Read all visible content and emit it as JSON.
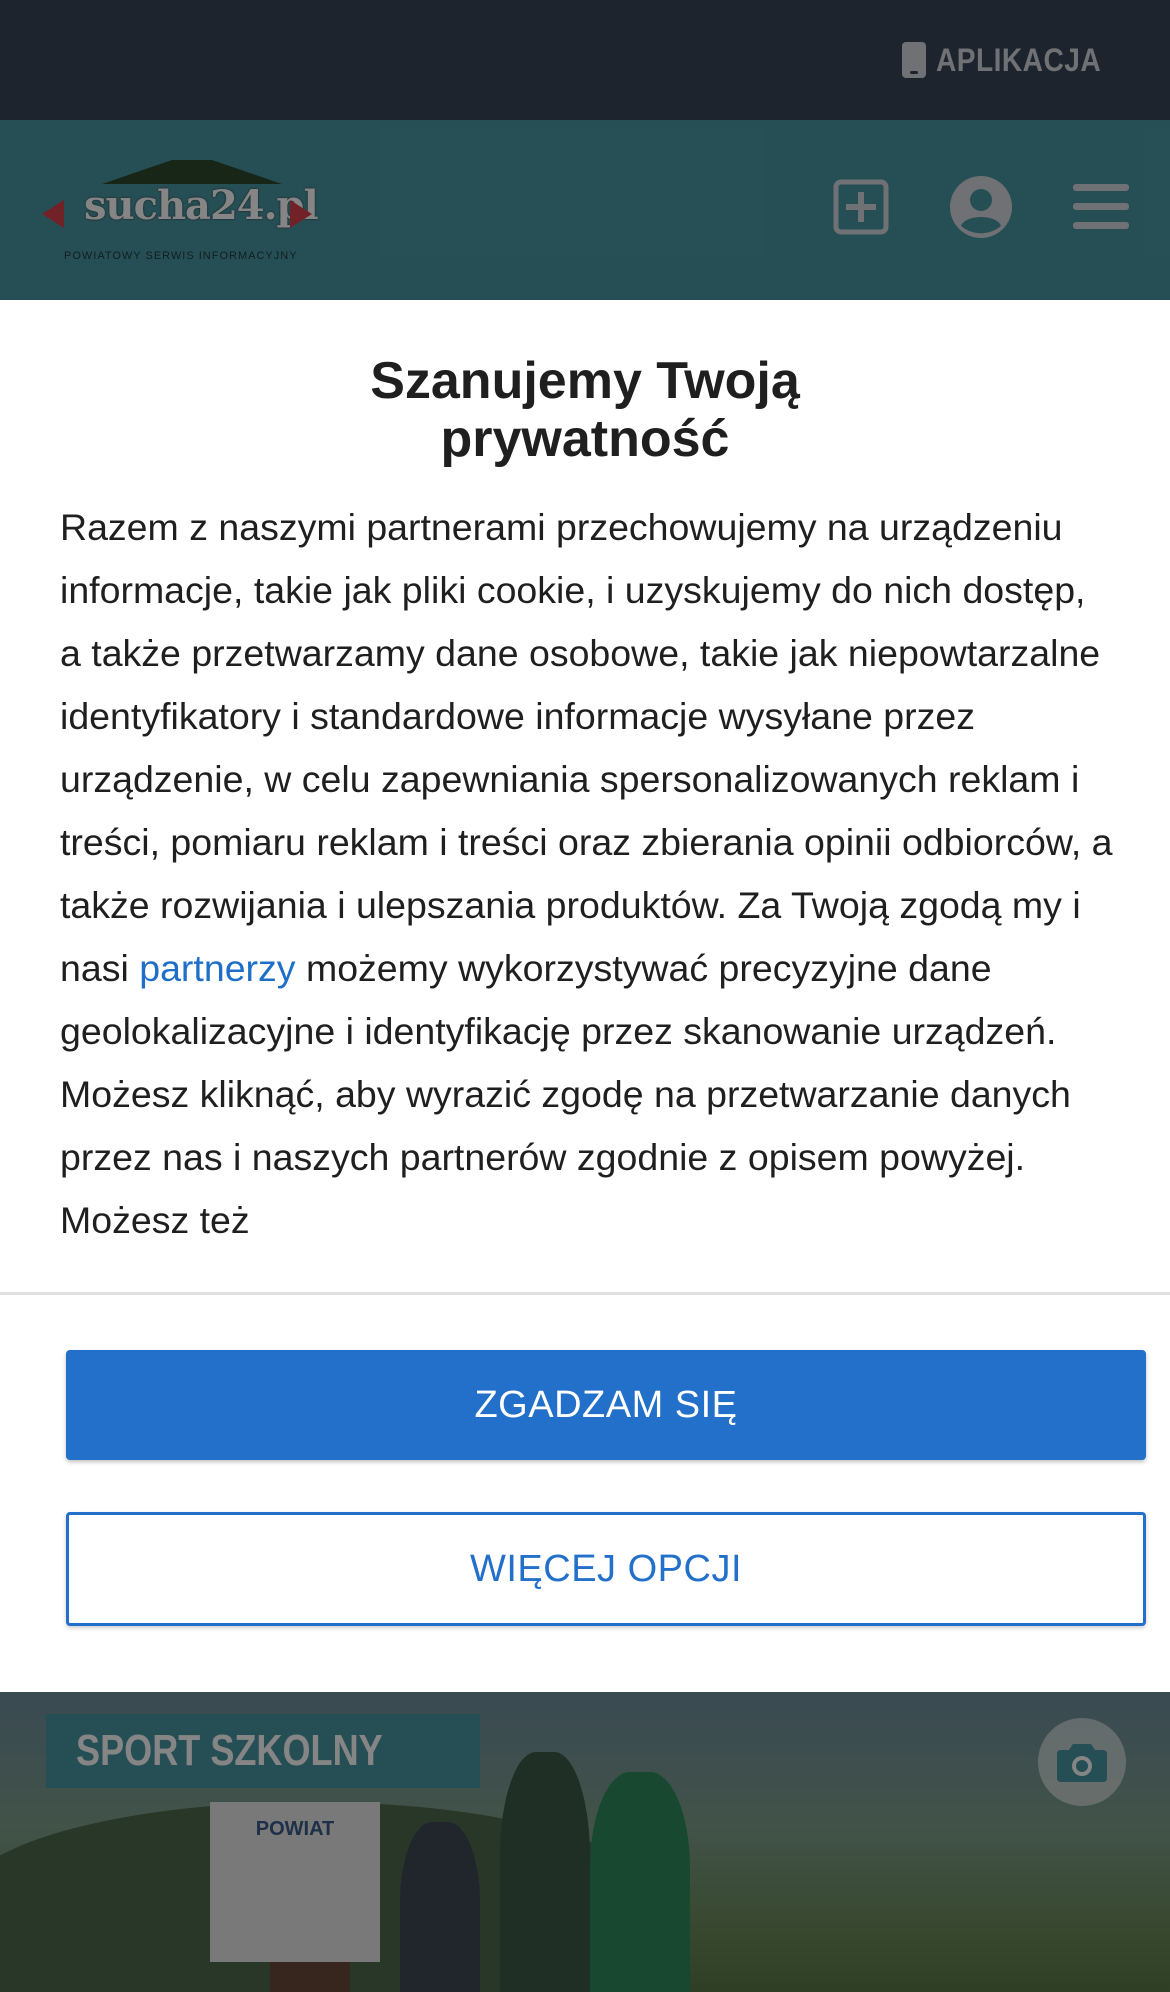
{
  "topbar": {
    "app_label": "APLIKACJA"
  },
  "site": {
    "logo_text": "sucha24.pl",
    "logo_subtitle": "POWIATOWY SERWIS INFORMACYJNY"
  },
  "consent": {
    "title_line1": "Szanujemy Twoją",
    "title_line2": "prywatność",
    "body_part1": "Razem z naszymi partnerami przechowujemy na urządzeniu informacje, takie jak pliki cookie, i uzyskujemy do nich dostęp, a także przetwarzamy dane osobowe, takie jak niepowtarzalne identyfikatory i standardowe informacje wysyłane przez urządzenie, w celu zapewniania spersonalizowanych reklam i treści, pomiaru reklam i treści oraz zbierania opinii odbiorców, a także rozwijania i ulepszania produktów. Za Twoją zgodą my i nasi ",
    "body_link": "partnerzy",
    "body_part2": " możemy wykorzystywać precyzyjne dane geolokalizacyjne i identyfikację przez skanowanie urządzeń. Możesz kliknąć, aby wyrazić zgodę na przetwarzanie danych przez nas i naszych partnerów zgodnie z opisem powyżej. Możesz też",
    "agree_label": "ZGADZAM SIĘ",
    "more_label": "WIĘCEJ OPCJI"
  },
  "hero": {
    "category_label": "SPORT SZKOLNY",
    "banner_text": "POWIAT"
  },
  "colors": {
    "topbar_bg": "#3a4556",
    "header_bg": "#4a97a4",
    "primary_blue": "#2270c9",
    "link_blue": "#1f6fc8"
  },
  "icons": {
    "topbar": "phone-icon",
    "header": [
      "add-post-icon",
      "user-account-icon",
      "hamburger-menu-icon"
    ],
    "hero": "camera-icon"
  }
}
